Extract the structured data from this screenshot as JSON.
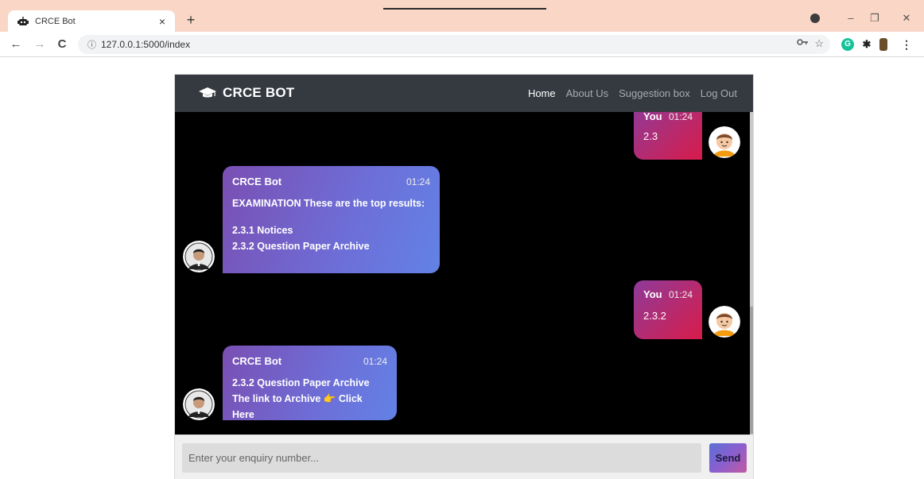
{
  "browser": {
    "tab_title": "CRCE Bot",
    "tab_close": "×",
    "new_tab": "+",
    "url": "127.0.0.1:5000/index",
    "window_controls": {
      "minimize": "–",
      "restore": "❐",
      "close": "✕"
    },
    "icons": {
      "back": "←",
      "forward": "→",
      "reload": "C",
      "info": "ⓘ",
      "key": "🔑",
      "star": "☆"
    }
  },
  "navbar": {
    "brand": "CRCE BOT",
    "links": [
      {
        "label": "Home",
        "active": true
      },
      {
        "label": "About Us",
        "active": false
      },
      {
        "label": "Suggestion box",
        "active": false
      },
      {
        "label": "Log Out",
        "active": false
      }
    ]
  },
  "messages": [
    {
      "sender": "You",
      "time": "01:24",
      "lines": [
        "2.3"
      ]
    },
    {
      "sender": "CRCE Bot",
      "time": "01:24",
      "lines": [
        "EXAMINATION These are the top results:",
        "",
        "2.3.1 Notices",
        "2.3.2 Question Paper Archive"
      ]
    },
    {
      "sender": "You",
      "time": "01:24",
      "lines": [
        "2.3.2"
      ]
    },
    {
      "sender": "CRCE Bot",
      "time": "01:24",
      "lines": [
        "2.3.2 Question Paper Archive",
        "The link to Archive 👉 Click Here"
      ]
    }
  ],
  "input": {
    "placeholder": "Enter your enquiry number...",
    "send_label": "Send"
  },
  "colors": {
    "navbar": "#343a40",
    "chat_bg": "#000000",
    "user_bubble_start": "#8e3a9a",
    "user_bubble_end": "#d81b4a",
    "bot_bubble_start": "#7a4fb3",
    "bot_bubble_end": "#6282e6"
  }
}
